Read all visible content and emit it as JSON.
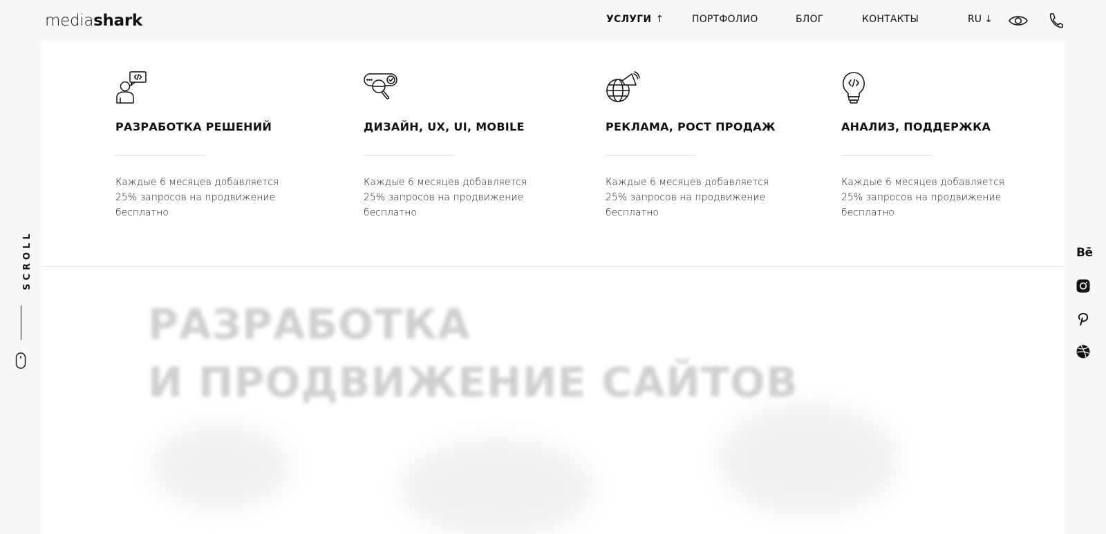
{
  "header": {
    "logo": {
      "light": "media",
      "bold": "shark"
    },
    "nav": [
      {
        "label": "УСЛУГИ",
        "arrow": "↑",
        "active": true
      },
      {
        "label": "ПОРТФОЛИО"
      },
      {
        "label": "БЛОГ"
      },
      {
        "label": "КОНТАКТЫ"
      }
    ],
    "lang": "RU ↓",
    "icons": [
      "eye-icon",
      "phone-icon"
    ]
  },
  "services": [
    {
      "title": "РАЗРАБОТКА РЕШЕНИЙ",
      "text": "Каждые 6 месяцев добавляется 25% запросов на продвижение бесплатно",
      "icon": "developer-chat-icon"
    },
    {
      "title": "ДИЗАЙН, UX, UI, MOBILE",
      "text": "Каждые 6 месяцев добавляется 25% запросов на продвижение бесплатно",
      "icon": "search-toggle-icon"
    },
    {
      "title": "РЕКЛАМА, РОСТ ПРОДАЖ",
      "text": "Каждые 6 месяцев добавляется 25% запросов на продвижение бесплатно",
      "icon": "globe-megaphone-icon"
    },
    {
      "title": "АНАЛИЗ, ПОДДЕРЖКА",
      "text": "Каждые 6 месяцев добавляется 25% запросов на продвижение бесплатно",
      "icon": "lightbulb-code-icon"
    }
  ],
  "hero": {
    "line1": "РАЗРАБОТКА",
    "line2": "И ПРОДВИЖЕНИЕ САЙТОВ"
  },
  "rail": {
    "scroll_label": "SCROLL",
    "icon": "mouse-icon"
  },
  "socials": {
    "behance_label": "Bē",
    "icons": [
      "behance-icon",
      "instagram-icon",
      "pinterest-icon",
      "dribbble-icon"
    ]
  },
  "colors": {
    "text": "#111111",
    "background": "#f8f8f8",
    "panel": "#ffffff"
  }
}
